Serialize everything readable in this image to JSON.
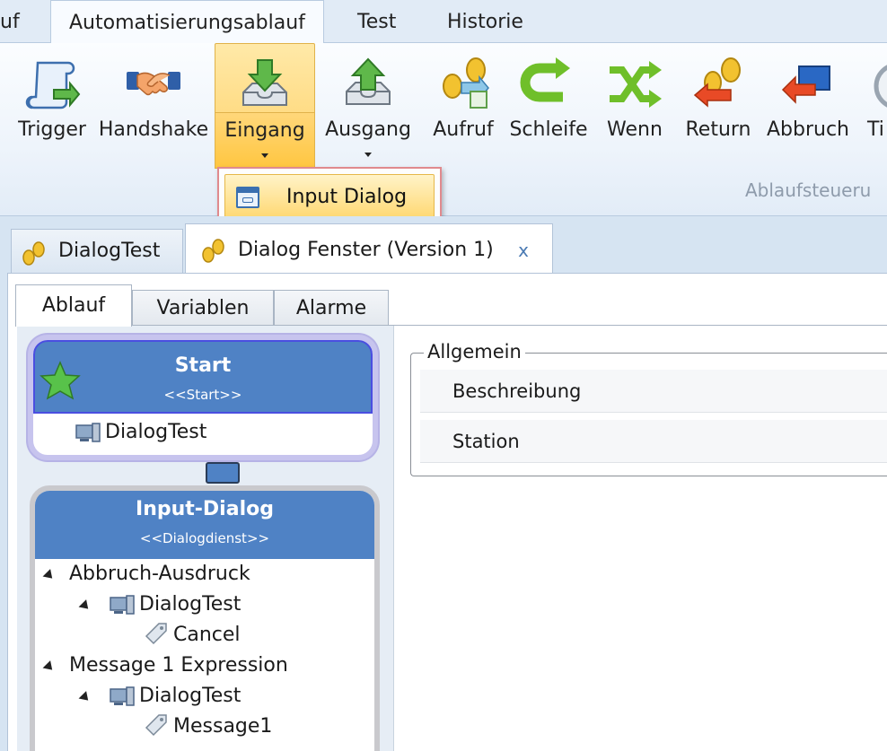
{
  "ribbon_tabs": [
    {
      "label": "uf"
    },
    {
      "label": "Automatisierungsablauf"
    },
    {
      "label": "Test"
    },
    {
      "label": "Historie"
    }
  ],
  "ribbon_buttons": [
    {
      "label": "Trigger",
      "icon": "scroll-arrow-icon"
    },
    {
      "label": "Handshake",
      "icon": "handshake-icon"
    },
    {
      "label": "Eingang",
      "icon": "inbox-down-arrow-icon"
    },
    {
      "label": "Ausgang",
      "icon": "outbox-up-arrow-icon"
    },
    {
      "label": "Aufruf",
      "icon": "footprints-call-icon"
    },
    {
      "label": "Schleife",
      "icon": "loop-arrow-icon"
    },
    {
      "label": "Wenn",
      "icon": "shuffle-icon"
    },
    {
      "label": "Return",
      "icon": "footprints-return-icon"
    },
    {
      "label": "Abbruch",
      "icon": "abort-arrow-icon"
    },
    {
      "label": "Ti",
      "icon": "timer-icon"
    }
  ],
  "ribbon_group_label": "Ablaufsteueru",
  "dropdown": {
    "item_label": "Input Dialog",
    "icon": "dialog-window-icon"
  },
  "doc_tabs": [
    {
      "label": "DialogTest"
    },
    {
      "label": "Dialog Fenster (Version 1)",
      "close": "x"
    }
  ],
  "sub_tabs": [
    {
      "label": "Ablauf"
    },
    {
      "label": "Variablen"
    },
    {
      "label": "Alarme"
    }
  ],
  "start_node": {
    "title": "Start",
    "stereotype": "<<Start>>",
    "item": "DialogTest"
  },
  "input_node": {
    "title": "Input-Dialog",
    "stereotype": "<<Dialogdienst>>",
    "tree": [
      {
        "text": "Abbruch-Ausdruck"
      },
      {
        "text": "DialogTest"
      },
      {
        "text": "Cancel"
      },
      {
        "text": "Message 1 Expression"
      },
      {
        "text": "DialogTest"
      },
      {
        "text": "Message1"
      }
    ]
  },
  "properties": {
    "legend": "Allgemein",
    "rows": [
      {
        "label": "Beschreibung"
      },
      {
        "label": "Station"
      }
    ]
  },
  "colors": {
    "accent_blue": "#4f82c5",
    "pressed_yellow": "#ffd26a",
    "popup_border": "#e08a8e"
  }
}
